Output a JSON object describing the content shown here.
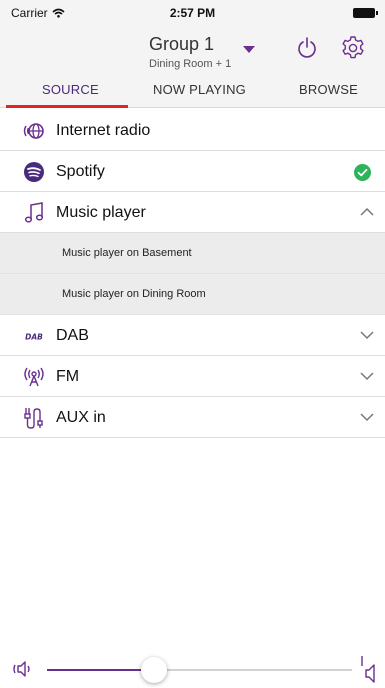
{
  "status_bar": {
    "carrier": "Carrier",
    "time": "2:57 PM"
  },
  "header": {
    "group_title": "Group 1",
    "group_subtitle": "Dining Room + 1"
  },
  "tabs": [
    {
      "label": "SOURCE",
      "active": true
    },
    {
      "label": "NOW PLAYING",
      "active": false
    },
    {
      "label": "BROWSE",
      "active": false
    }
  ],
  "sources": {
    "internet_radio": {
      "label": "Internet radio",
      "icon": "globe-radio-icon"
    },
    "spotify": {
      "label": "Spotify",
      "icon": "spotify-icon",
      "selected": true
    },
    "music_player": {
      "label": "Music player",
      "icon": "music-note-icon",
      "expanded": true,
      "children": [
        "Music player on Basement",
        "Music player on Dining Room"
      ]
    },
    "dab": {
      "label": "DAB",
      "icon": "dab-icon"
    },
    "fm": {
      "label": "FM",
      "icon": "fm-antenna-icon"
    },
    "aux": {
      "label": "AUX in",
      "icon": "aux-cable-icon"
    }
  },
  "volume": {
    "level": 0.35
  },
  "colors": {
    "accent": "#6b2f8e",
    "tab_underline": "#e02424",
    "selected_check": "#2db35a",
    "header_bg": "#f4f4f4"
  }
}
